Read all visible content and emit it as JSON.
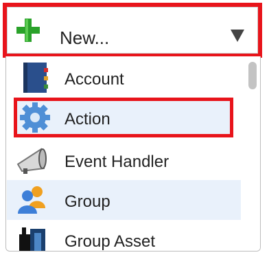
{
  "header": {
    "label": "New...",
    "icon": "plus-icon",
    "caret_icon": "chevron-down-icon"
  },
  "menu": {
    "items": [
      {
        "label": "Account",
        "icon": "account-book-icon"
      },
      {
        "label": "Action",
        "icon": "gear-icon"
      },
      {
        "label": "Event Handler",
        "icon": "megaphone-icon"
      },
      {
        "label": "Group",
        "icon": "users-group-icon"
      },
      {
        "label": "Group Asset",
        "icon": "group-asset-icon"
      }
    ]
  },
  "colors": {
    "highlight": "#e8141b",
    "selected_bg": "#e9f1fb",
    "plus_green": "#2aa22a"
  }
}
